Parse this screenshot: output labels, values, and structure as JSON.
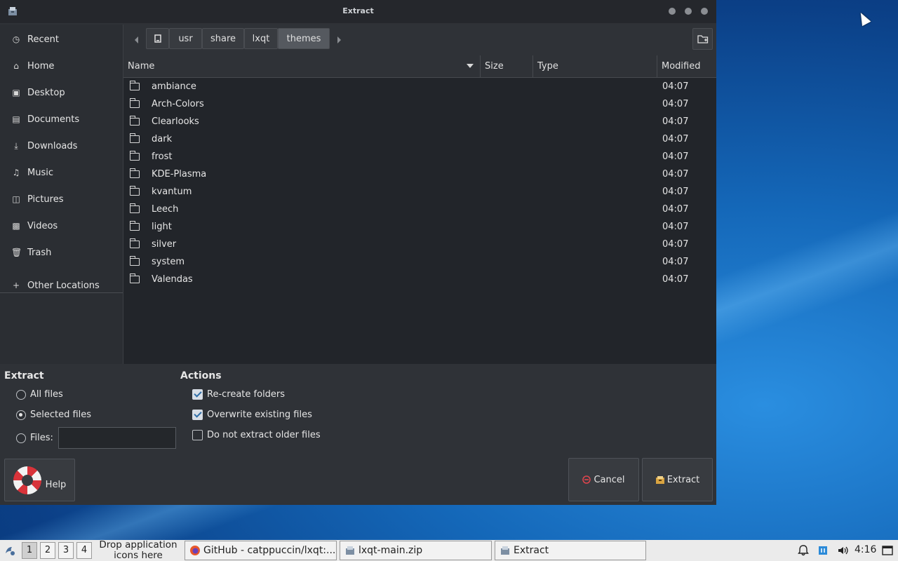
{
  "window": {
    "title": "Extract",
    "sidebar": {
      "items": [
        {
          "label": "Recent",
          "icon": "recent-icon"
        },
        {
          "label": "Home",
          "icon": "home-icon"
        },
        {
          "label": "Desktop",
          "icon": "desktop-icon"
        },
        {
          "label": "Documents",
          "icon": "documents-icon"
        },
        {
          "label": "Downloads",
          "icon": "downloads-icon"
        },
        {
          "label": "Music",
          "icon": "music-icon"
        },
        {
          "label": "Pictures",
          "icon": "pictures-icon"
        },
        {
          "label": "Videos",
          "icon": "videos-icon"
        },
        {
          "label": "Trash",
          "icon": "trash-icon"
        }
      ],
      "other_locations": "Other Locations"
    },
    "pathbar": {
      "segments": [
        "usr",
        "share",
        "lxqt",
        "themes"
      ],
      "active_segment": "themes"
    },
    "columns": {
      "name": "Name",
      "size": "Size",
      "type": "Type",
      "modified": "Modified"
    },
    "files": [
      {
        "name": "ambiance",
        "modified": "04:07"
      },
      {
        "name": "Arch-Colors",
        "modified": "04:07"
      },
      {
        "name": "Clearlooks",
        "modified": "04:07"
      },
      {
        "name": "dark",
        "modified": "04:07"
      },
      {
        "name": "frost",
        "modified": "04:07"
      },
      {
        "name": "KDE-Plasma",
        "modified": "04:07"
      },
      {
        "name": "kvantum",
        "modified": "04:07"
      },
      {
        "name": "Leech",
        "modified": "04:07"
      },
      {
        "name": "light",
        "modified": "04:07"
      },
      {
        "name": "silver",
        "modified": "04:07"
      },
      {
        "name": "system",
        "modified": "04:07"
      },
      {
        "name": "Valendas",
        "modified": "04:07"
      }
    ],
    "extract": {
      "title": "Extract",
      "all_files": "All files",
      "selected_files": "Selected files",
      "files_label": "Files:",
      "files_value": "",
      "selected": "selected_files"
    },
    "actions": {
      "title": "Actions",
      "recreate_folders": {
        "label": "Re-create folders",
        "checked": true
      },
      "overwrite_existing": {
        "label": "Overwrite existing files",
        "checked": true
      },
      "do_not_extract_older": {
        "label": "Do not extract older files",
        "checked": false
      }
    },
    "buttons": {
      "help": "Help",
      "cancel": "Cancel",
      "extract": "Extract"
    }
  },
  "taskbar": {
    "workspaces": [
      "1",
      "2",
      "3",
      "4"
    ],
    "active_workspace": "1",
    "drop_text": "Drop application icons here",
    "tasks": [
      {
        "label": "GitHub - catppuccin/lxqt:...",
        "icon": "firefox-icon"
      },
      {
        "label": "lxqt-main.zip",
        "icon": "archiver-icon"
      },
      {
        "label": "Extract",
        "icon": "archiver-icon"
      }
    ],
    "clock": "4:16"
  },
  "colors": {
    "window_bg": "#2f3237",
    "list_bg": "#22252a",
    "taskbar_bg": "#ebebeb",
    "accent": "#2f6ea8"
  }
}
